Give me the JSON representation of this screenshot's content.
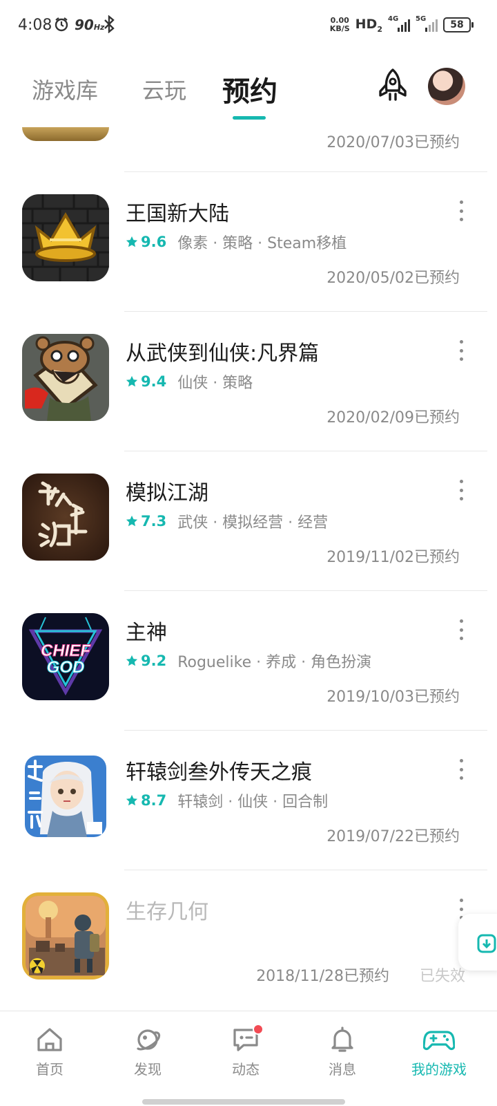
{
  "status_bar": {
    "time": "4:08",
    "refresh": "90",
    "refresh_unit": "Hz",
    "speed_value": "0.00",
    "speed_unit": "KB/S",
    "hd": "HD",
    "hd_sub": "2",
    "sig1": "4G",
    "sig2": "5G",
    "battery": "58"
  },
  "top_tabs": [
    {
      "label": "游戏库",
      "active": false
    },
    {
      "label": "云玩",
      "active": false
    },
    {
      "label": "预约",
      "active": true
    }
  ],
  "partial_item": {
    "date": "2020/07/03已预约"
  },
  "items": [
    {
      "title": "王国新大陆",
      "score": "9.6",
      "tags": "像素 · 策略 · Steam移植",
      "date": "2020/05/02已预约",
      "icon": "crown-icon"
    },
    {
      "title": "从武侠到仙侠:凡界篇",
      "score": "9.4",
      "tags": "仙侠 · 策略",
      "date": "2020/02/09已预约",
      "icon": "tiger-hat-hero-icon"
    },
    {
      "title": "模拟江湖",
      "score": "7.3",
      "tags": "武侠 · 模拟经营 · 经营",
      "date": "2019/11/02已预约",
      "icon": "calligraphy-icon"
    },
    {
      "title": "主神",
      "score": "9.2",
      "tags": "Roguelike · 养成 · 角色扮演",
      "date": "2019/10/03已预约",
      "icon": "chief-god-logo-icon"
    },
    {
      "title": "轩辕剑叁外传天之痕",
      "score": "8.7",
      "tags": "轩辕剑 · 仙侠 · 回合制",
      "date": "2019/07/22已预约",
      "icon": "anime-girl-icon"
    },
    {
      "title": "生存几何",
      "score": "",
      "tags": "",
      "date": "2018/11/28已预约",
      "status": "已失效",
      "icon": "nuclear-survivor-icon"
    }
  ],
  "chief_god_logo": {
    "line1": "CHIEF",
    "line2": "GOD"
  },
  "bottom_nav": [
    {
      "label": "首页",
      "icon": "home-icon",
      "active": false
    },
    {
      "label": "发现",
      "icon": "planet-icon",
      "active": false
    },
    {
      "label": "动态",
      "icon": "chat-icon",
      "active": false,
      "badge": true
    },
    {
      "label": "消息",
      "icon": "bell-icon",
      "active": false
    },
    {
      "label": "我的游戏",
      "icon": "gamepad-icon",
      "active": true
    }
  ],
  "colors": {
    "accent": "#16b8b0",
    "text": "#1c1c1c",
    "muted": "#8a8a8a",
    "badge": "#f24b54"
  }
}
